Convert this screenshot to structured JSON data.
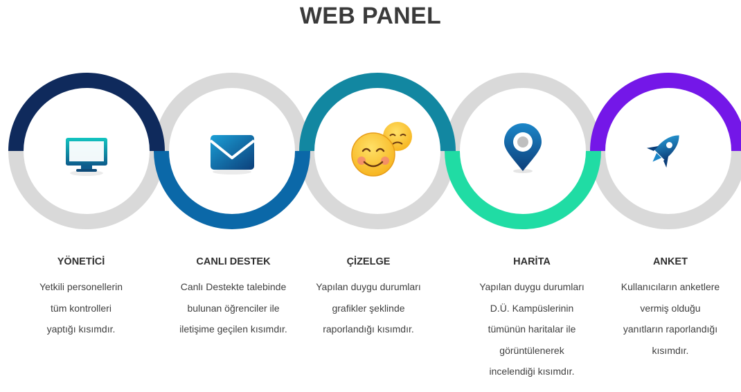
{
  "page_title": "WEB PANEL",
  "features": [
    {
      "title": "YÖNETİCİ",
      "description": "Yetkili personellerin\ntüm kontrolleri\nyaptığı kısımdır.",
      "icon": "computer-monitor-icon",
      "accent": "#0f2a5c",
      "accent_half": "top"
    },
    {
      "title": "CANLI DESTEK",
      "description": "Canlı Destekte talebinde\nbulunan öğrenciler ile\niletişime geçilen kısımdır.",
      "icon": "envelope-icon",
      "accent": "#0b68a8",
      "accent_half": "bottom"
    },
    {
      "title": "ÇİZELGE",
      "description": "Yapılan duygu durumları\ngrafikler şeklinde\nraporlandığı kısımdır.",
      "icon": "emoji-faces-icon",
      "accent": "#1287a1",
      "accent_half": "top"
    },
    {
      "title": "HARİTA",
      "description": "Yapılan duygu durumları\nD.Ü. Kampüslerinin\ntümünün haritalar ile\ngörüntülenerek\nincelendiği kısımdır.",
      "icon": "map-pin-icon",
      "accent": "#20dca4",
      "accent_half": "bottom"
    },
    {
      "title": "ANKET",
      "description": "Kullanıcıların anketlere\nvermiş olduğu\nyanıtların raporlandığı\nkısımdır.",
      "icon": "rocket-icon",
      "accent": "#7417e8",
      "accent_half": "top"
    }
  ],
  "ring_gray": "#d9d9d9"
}
